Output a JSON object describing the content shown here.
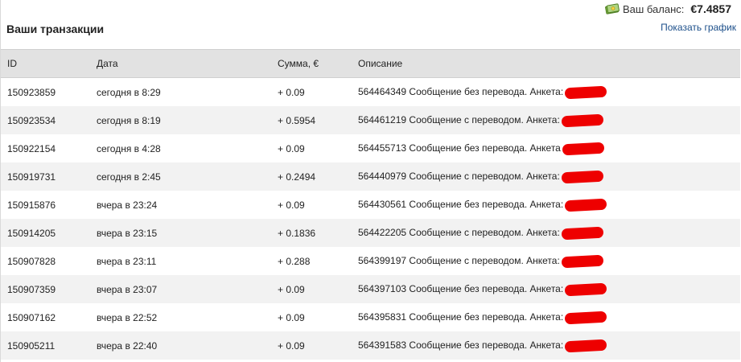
{
  "balance": {
    "label": "Ваш баланс:",
    "value": "€7.4857"
  },
  "header": {
    "title": "Ваши транзакции",
    "show_chart": "Показать график"
  },
  "table": {
    "columns": [
      "ID",
      "Дата",
      "Сумма, €",
      "Описание"
    ],
    "rows": [
      {
        "id": "150923859",
        "date": "сегодня в 8:29",
        "amount": "+ 0.09",
        "description": "564464349 Сообщение без перевода. Анкета:"
      },
      {
        "id": "150923534",
        "date": "сегодня в 8:19",
        "amount": "+ 0.5954",
        "description": "564461219 Сообщение с переводом. Анкета:"
      },
      {
        "id": "150922154",
        "date": "сегодня в 4:28",
        "amount": "+ 0.09",
        "description": "564455713 Сообщение без перевода. Анкета"
      },
      {
        "id": "150919731",
        "date": "сегодня в 2:45",
        "amount": "+ 0.2494",
        "description": "564440979 Сообщение с переводом. Анкета:"
      },
      {
        "id": "150915876",
        "date": "вчера в 23:24",
        "amount": "+ 0.09",
        "description": "564430561 Сообщение без перевода. Анкета:"
      },
      {
        "id": "150914205",
        "date": "вчера в 23:15",
        "amount": "+ 0.1836",
        "description": "564422205 Сообщение с переводом. Анкета:"
      },
      {
        "id": "150907828",
        "date": "вчера в 23:11",
        "amount": "+ 0.288",
        "description": "564399197 Сообщение с переводом. Анкета:"
      },
      {
        "id": "150907359",
        "date": "вчера в 23:07",
        "amount": "+ 0.09",
        "description": "564397103 Сообщение без перевода. Анкета:"
      },
      {
        "id": "150907162",
        "date": "вчера в 22:52",
        "amount": "+ 0.09",
        "description": "564395831 Сообщение без перевода. Анкета:"
      },
      {
        "id": "150905211",
        "date": "вчера в 22:40",
        "amount": "+ 0.09",
        "description": "564391583 Сообщение без перевода. Анкета:"
      }
    ]
  },
  "icons": {
    "balance_icon": "money-icon",
    "redaction": "redaction-scribble"
  },
  "colors": {
    "link": "#1c4f8a",
    "header_bg": "#e2e2e2",
    "row_alt_bg": "#f2f2f2",
    "redaction": "#ee0000"
  }
}
